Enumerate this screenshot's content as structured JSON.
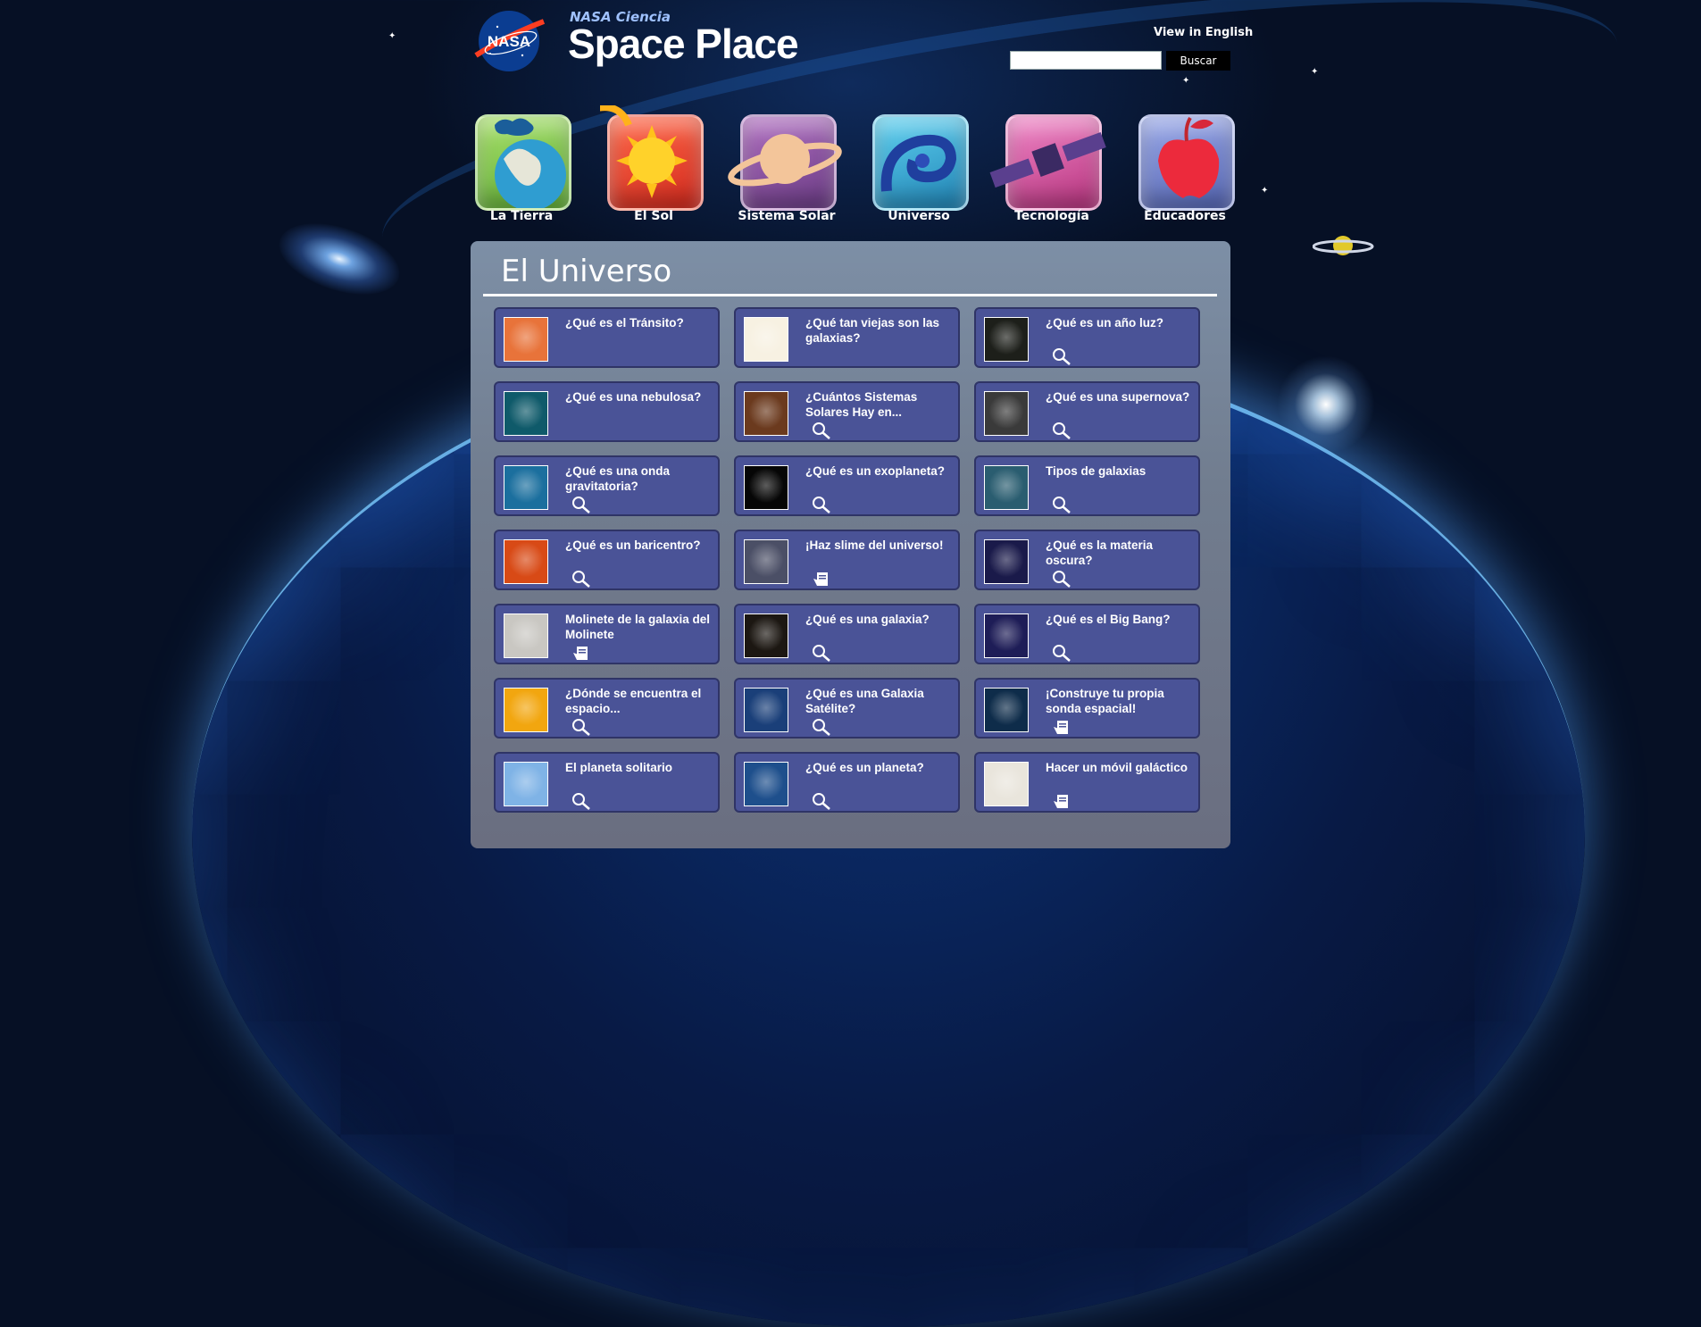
{
  "header": {
    "nasa_logo_text": "NASA",
    "brand_small": "NASA Ciencia",
    "brand_big": "Space Place",
    "view_english": "View in English",
    "search_placeholder": "",
    "search_button": "Buscar"
  },
  "nav": [
    {
      "label": "La Tierra",
      "icon": "earth-icon",
      "color": "#6fbf3a"
    },
    {
      "label": "El Sol",
      "icon": "sun-icon",
      "color": "#e8432b"
    },
    {
      "label": "Sistema Solar",
      "icon": "saturn-icon",
      "color": "#8a4f9e"
    },
    {
      "label": "Universo",
      "icon": "galaxy-icon",
      "color": "#2aa0c8"
    },
    {
      "label": "Tecnología",
      "icon": "satellite-icon",
      "color": "#c2449a"
    },
    {
      "label": "Educadores",
      "icon": "apple-icon",
      "color": "#6b7fc8"
    }
  ],
  "panel": {
    "title": "El Universo"
  },
  "cards": [
    {
      "title": "¿Qué es el Tránsito?",
      "icon": "",
      "thumb": "#e8733a"
    },
    {
      "title": "¿Qué tan viejas son las galaxias?",
      "icon": "",
      "thumb": "#f7f1e2"
    },
    {
      "title": "¿Qué es un año luz?",
      "icon": "magnifier-icon",
      "thumb": "#1d1f1a"
    },
    {
      "title": "¿Qué es una nebulosa?",
      "icon": "",
      "thumb": "#0f5a6a"
    },
    {
      "title": "¿Cuántos Sistemas Solares Hay en...",
      "icon": "magnifier-icon",
      "thumb": "#6b3a1e"
    },
    {
      "title": "¿Qué es una supernova?",
      "icon": "magnifier-icon",
      "thumb": "#3a3a3a"
    },
    {
      "title": "¿Qué es una onda gravitatoria?",
      "icon": "magnifier-icon",
      "thumb": "#1b6f9e"
    },
    {
      "title": "¿Qué es un exoplaneta?",
      "icon": "magnifier-icon",
      "thumb": "#060606"
    },
    {
      "title": "Tipos de galaxias",
      "icon": "magnifier-icon",
      "thumb": "#2a5d70"
    },
    {
      "title": "¿Qué es un baricentro?",
      "icon": "magnifier-icon",
      "thumb": "#d84a16"
    },
    {
      "title": "¡Haz slime del universo!",
      "icon": "activity-icon",
      "thumb": "#4b4f66"
    },
    {
      "title": "¿Qué es la materia oscura?",
      "icon": "magnifier-icon",
      "thumb": "#1a1a4a"
    },
    {
      "title": "Molinete de la galaxia del Molinete",
      "icon": "activity-icon",
      "thumb": "#c9c7c2"
    },
    {
      "title": "¿Qué es una galaxia?",
      "icon": "magnifier-icon",
      "thumb": "#1c1712"
    },
    {
      "title": "¿Qué es el Big Bang?",
      "icon": "magnifier-icon",
      "thumb": "#1e1d57"
    },
    {
      "title": "¿Dónde se encuentra el espacio...",
      "icon": "magnifier-icon",
      "thumb": "#f2a60f"
    },
    {
      "title": "¿Qué es una Galaxia Satélite?",
      "icon": "magnifier-icon",
      "thumb": "#1a3f79"
    },
    {
      "title": "¡Construye tu propia sonda espacial!",
      "icon": "activity-icon",
      "thumb": "#0e2c4a"
    },
    {
      "title": "El planeta solitario",
      "icon": "magnifier-icon",
      "thumb": "#7fb3e6"
    },
    {
      "title": "¿Qué es un planeta?",
      "icon": "magnifier-icon",
      "thumb": "#1e4f8c"
    },
    {
      "title": "Hacer un móvil galáctico",
      "icon": "activity-icon",
      "thumb": "#e9e5dc"
    }
  ]
}
